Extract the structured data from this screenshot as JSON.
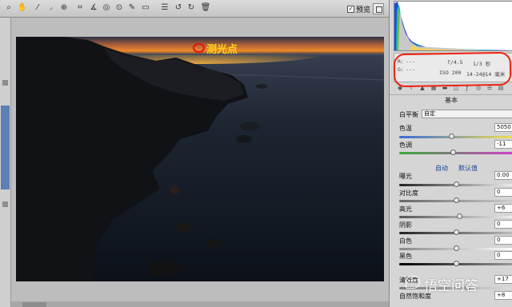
{
  "toolbar": {
    "tools": [
      "zoom-icon",
      "hand-icon",
      "white-balance-icon",
      "color-sampler-icon",
      "target-adjust-icon",
      "crop-icon",
      "straighten-icon",
      "spot-removal-icon",
      "red-eye-icon",
      "adjustment-brush-icon",
      "graduated-filter-icon",
      "preferences-icon",
      "rotate-left-icon",
      "rotate-right-icon",
      "trash-icon"
    ],
    "preview_label": "预览",
    "preview_checked": true
  },
  "image": {
    "annotation_label": "测光点"
  },
  "info": {
    "r_label": "R:",
    "r_value": "---",
    "g_label": "G:",
    "g_value": "---",
    "aperture": "f/4.5",
    "shutter": "1/3 秒",
    "iso": "ISO 200",
    "focal": "14-24@14 毫米"
  },
  "panel": {
    "section_title": "基本",
    "white_balance": {
      "label": "白平衡",
      "value": "自定"
    },
    "temperature": {
      "label": "色温",
      "value": "5050"
    },
    "tint": {
      "label": "色调",
      "value": "-11"
    },
    "auto_link": "自动",
    "default_link": "默认值",
    "exposure": {
      "label": "曝光",
      "value": "0.00"
    },
    "contrast": {
      "label": "对比度",
      "value": "0"
    },
    "highlights": {
      "label": "高光",
      "value": "+6"
    },
    "shadows": {
      "label": "阴影",
      "value": "0"
    },
    "whites": {
      "label": "白色",
      "value": "0"
    },
    "blacks": {
      "label": "黑色",
      "value": "0"
    },
    "clarity": {
      "label": "清晰度",
      "value": "+17"
    },
    "vibrance": {
      "label": "自然饱和度",
      "value": "+8"
    }
  },
  "watermark": {
    "text": "悟空问答"
  }
}
